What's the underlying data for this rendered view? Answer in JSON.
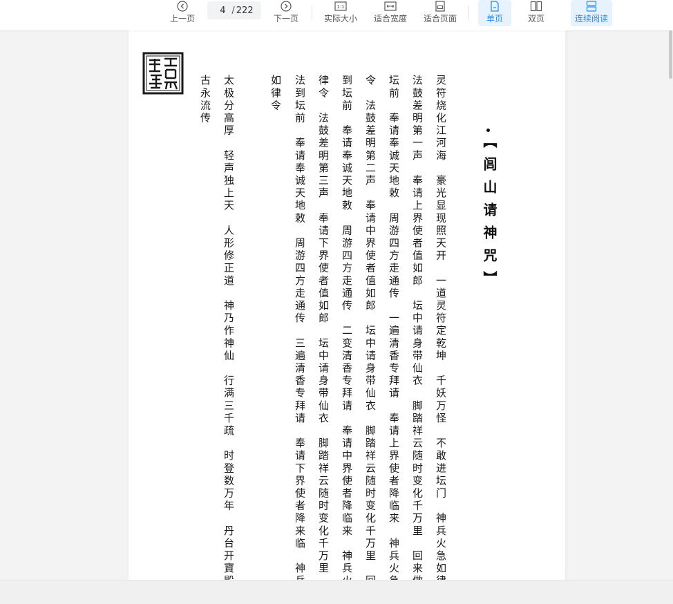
{
  "toolbar": {
    "prev_label": "上一页",
    "next_label": "下一页",
    "actual_size_label": "实际大小",
    "fit_width_label": "适合宽度",
    "fit_page_label": "适合页面",
    "single_page_label": "单页",
    "double_page_label": "双页",
    "continuous_label": "连续阅读",
    "current_page": "4",
    "total_pages": "222",
    "page_separator": "/",
    "accent_color": "#1f8ef1"
  },
  "document": {
    "title": "【闾山请神咒】",
    "columns": [
      "灵符烧化江河海　豪光显现照天开　一道灵符定乾坤　千妖万怪　不敢进坛门　神兵火急如律",
      "法鼓差明第一声　奉请上界使者值如郎　坛中请身带仙衣　脚踏祥云随时变化千万里　回来做",
      "坛前　奉请奉诚天地敕　周游四方走通传　一遍清香专拜请　奉请上界使者降临来　神兵火急",
      "令　法鼓差明第二声　奉请中界使者值如郎　坛中请身带仙衣　脚踏祥云随时变化千万里　回来",
      "到坛前　奉请奉诚天地敕　周游四方走通传　二变清香专拜请　奉请中界使者降临来　神兵火",
      "律令　法鼓差明第三声　奉请下界使者值如郎　坛中请身带仙衣　脚踏祥云随时变化千万里　回",
      "法到坛前　奉请奉诚天地敕　周游四方走通传　三遍清香专拜请　奉请下界使者降来临　神兵",
      "如律令",
      "太极分高厚　轻声独上天　人形修正道　神乃作神仙　行满三千疏　时登数万年　丹台开寶殿",
      "古永流传"
    ]
  }
}
